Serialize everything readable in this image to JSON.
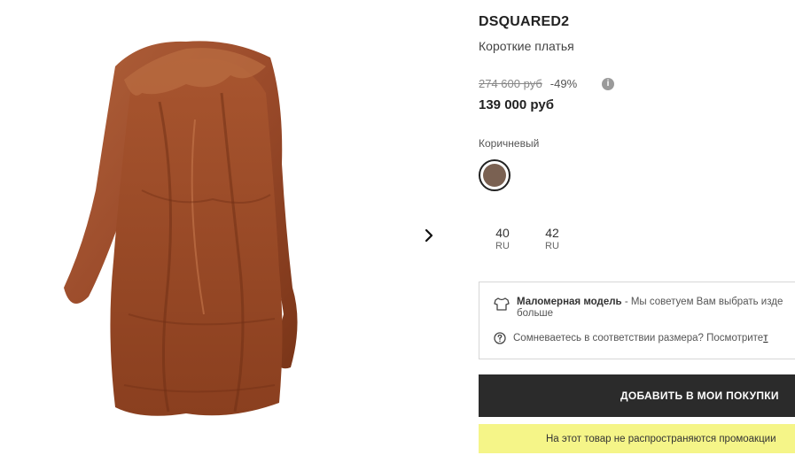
{
  "product": {
    "brand": "DSQUARED2",
    "category": "Короткие платья",
    "old_price": "274 600 руб",
    "discount": "-49%",
    "price": "139 000 руб",
    "color_label": "Коричневый",
    "swatch_color": "#7a6152",
    "image_color": "#9a4a2a"
  },
  "sizes": [
    {
      "value": "40",
      "unit": "RU"
    },
    {
      "value": "42",
      "unit": "RU"
    }
  ],
  "fit": {
    "title": "Маломерная модель",
    "text": " - Мы советуем Вам выбрать изде",
    "more": "больше",
    "question": "Сомневаетесь в соответствии размера? Посмотрите ",
    "link": "т"
  },
  "actions": {
    "add_to_cart": "ДОБАВИТЬ В МОИ ПОКУПКИ"
  },
  "promo": {
    "text": "На этот товар не распространяются промоакции"
  },
  "icons": {
    "info": "info-icon",
    "next": "chevron-right-icon",
    "shirt": "shirt-icon",
    "help": "question-circle-icon"
  }
}
